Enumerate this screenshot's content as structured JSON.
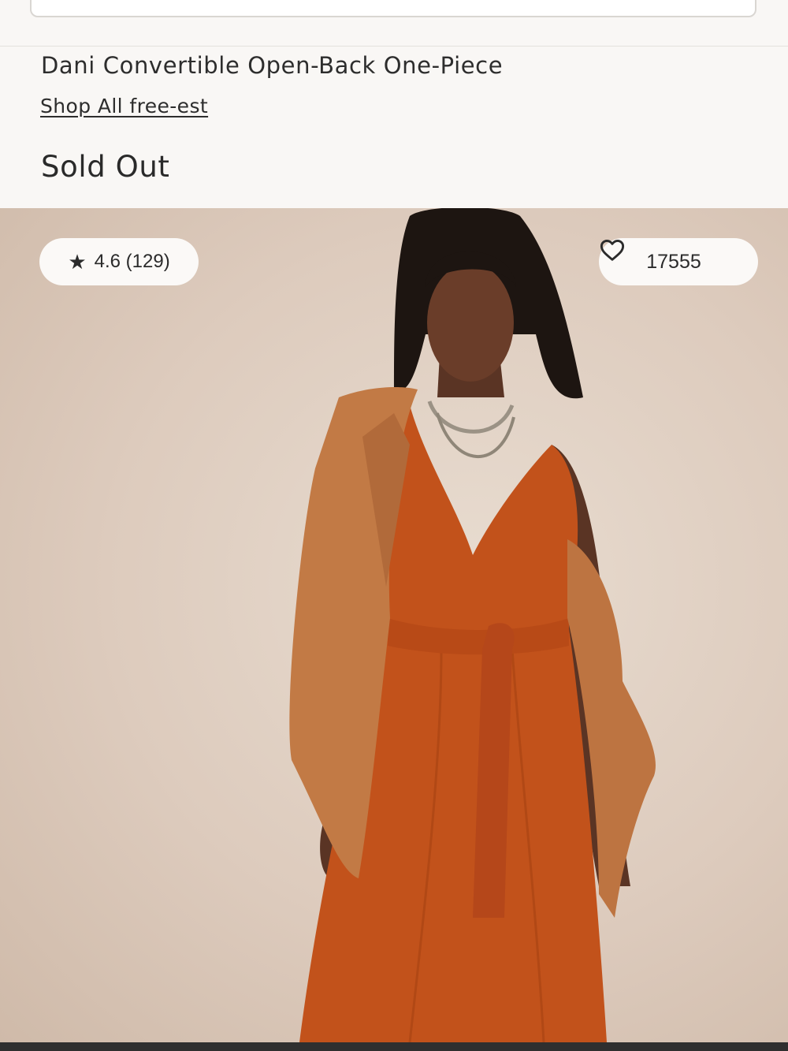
{
  "header": {
    "search_value": ""
  },
  "product": {
    "title": "Dani Convertible Open-Back One-Piece",
    "brand_link": "Shop All free-est",
    "status": "Sold Out"
  },
  "image": {
    "rating_star": "★",
    "rating_text": "4.6 (129)",
    "likes_count": "17555",
    "heart_icon": "heart-outline-icon"
  },
  "colors": {
    "background": "#f9f7f5",
    "text": "#2b2b2b",
    "pill_bg": "#fbf9f7",
    "dress": "#c2521b",
    "jacket": "#c27a45"
  }
}
